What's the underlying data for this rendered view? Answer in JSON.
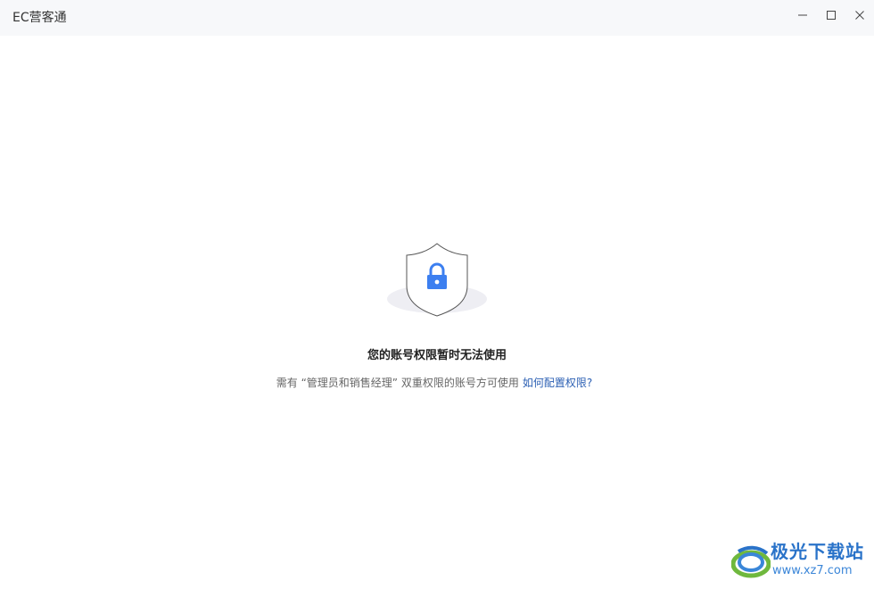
{
  "app": {
    "title": "EC营客通"
  },
  "titlebar": {
    "icons": [
      "minimize-icon",
      "maximize-icon",
      "close-icon"
    ]
  },
  "message": {
    "title": "您的账号权限暂时无法使用",
    "description": "需有 “管理员和销售经理” 双重权限的账号方可使用",
    "link": "如何配置权限?"
  },
  "illustration": {
    "icon": "shield-lock-icon",
    "accent_color": "#3c7ff0",
    "shadow_color": "#eeeef3"
  },
  "watermark": {
    "name": "极光下载站",
    "url": "www.xz7.com",
    "color": "#2a73c9"
  }
}
